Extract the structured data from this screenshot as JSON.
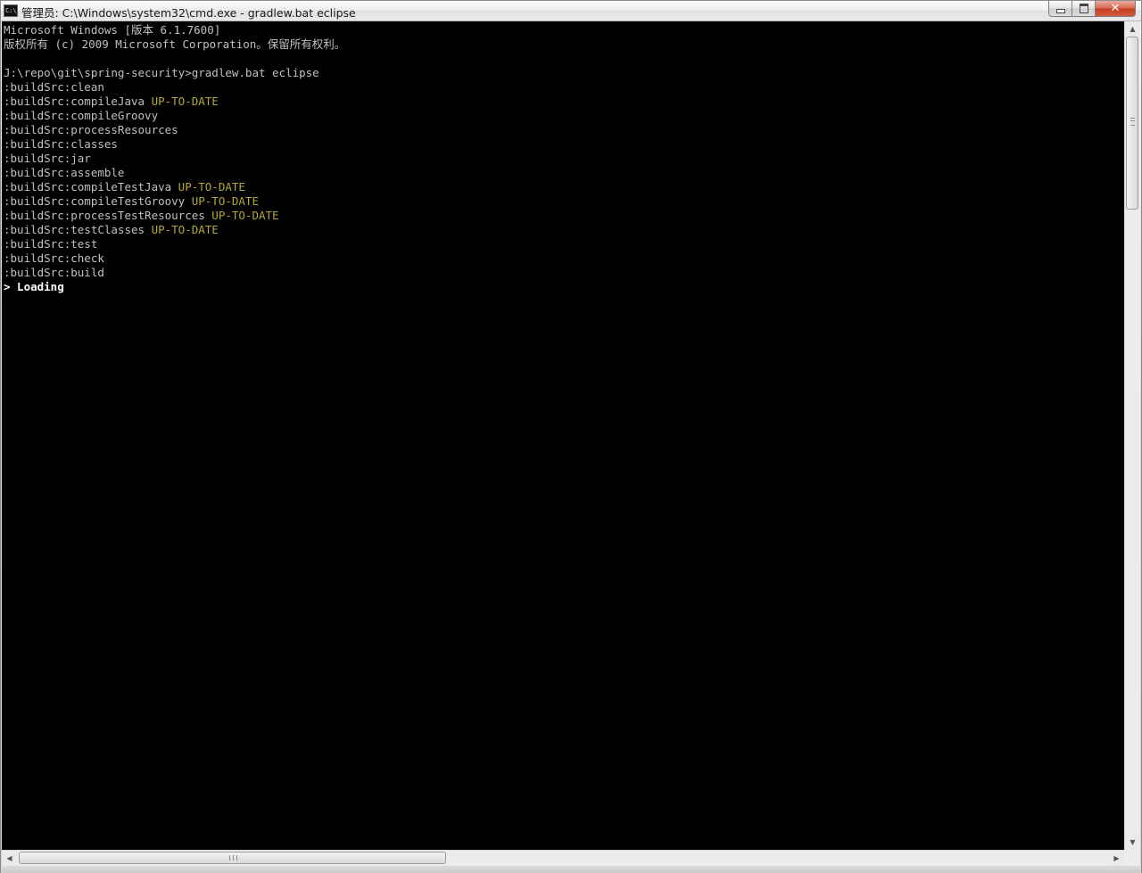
{
  "window": {
    "title": "管理员: C:\\Windows\\system32\\cmd.exe - gradlew.bat  eclipse",
    "icon": "cmd-icon",
    "icon_text": "C:\\"
  },
  "console": {
    "lines": [
      [
        {
          "text": "Microsoft Windows [版本 6.1.7600]",
          "color": "default"
        }
      ],
      [
        {
          "text": "版权所有 (c) 2009 Microsoft Corporation。保留所有权利。",
          "color": "default"
        }
      ],
      [
        {
          "text": "",
          "color": "default"
        }
      ],
      [
        {
          "text": "J:\\repo\\git\\spring-security>gradlew.bat eclipse",
          "color": "default"
        }
      ],
      [
        {
          "text": ":buildSrc:clean",
          "color": "default"
        }
      ],
      [
        {
          "text": ":buildSrc:compileJava ",
          "color": "default"
        },
        {
          "text": "UP-TO-DATE",
          "color": "yellow"
        }
      ],
      [
        {
          "text": ":buildSrc:compileGroovy",
          "color": "default"
        }
      ],
      [
        {
          "text": ":buildSrc:processResources",
          "color": "default"
        }
      ],
      [
        {
          "text": ":buildSrc:classes",
          "color": "default"
        }
      ],
      [
        {
          "text": ":buildSrc:jar",
          "color": "default"
        }
      ],
      [
        {
          "text": ":buildSrc:assemble",
          "color": "default"
        }
      ],
      [
        {
          "text": ":buildSrc:compileTestJava ",
          "color": "default"
        },
        {
          "text": "UP-TO-DATE",
          "color": "yellow"
        }
      ],
      [
        {
          "text": ":buildSrc:compileTestGroovy ",
          "color": "default"
        },
        {
          "text": "UP-TO-DATE",
          "color": "yellow"
        }
      ],
      [
        {
          "text": ":buildSrc:processTestResources ",
          "color": "default"
        },
        {
          "text": "UP-TO-DATE",
          "color": "yellow"
        }
      ],
      [
        {
          "text": ":buildSrc:testClasses ",
          "color": "default"
        },
        {
          "text": "UP-TO-DATE",
          "color": "yellow"
        }
      ],
      [
        {
          "text": ":buildSrc:test",
          "color": "default"
        }
      ],
      [
        {
          "text": ":buildSrc:check",
          "color": "default"
        }
      ],
      [
        {
          "text": ":buildSrc:build",
          "color": "default"
        }
      ],
      [
        {
          "text": "> Loading",
          "color": "bright"
        }
      ]
    ]
  },
  "colors": {
    "default": "#c0c0c0",
    "yellow": "#b5a632",
    "bright": "#ffffff",
    "background": "#000000"
  }
}
